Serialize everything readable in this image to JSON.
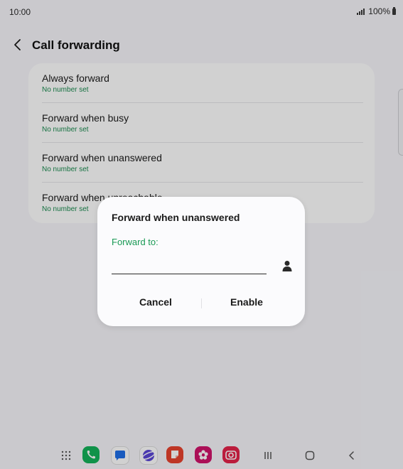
{
  "status_bar": {
    "time": "10:00",
    "battery": "100%"
  },
  "header": {
    "title": "Call forwarding"
  },
  "options": [
    {
      "title": "Always forward",
      "subtitle": "No number set"
    },
    {
      "title": "Forward when busy",
      "subtitle": "No number set"
    },
    {
      "title": "Forward when unanswered",
      "subtitle": "No number set"
    },
    {
      "title": "Forward when unreachable",
      "subtitle": "No number set"
    }
  ],
  "dialog": {
    "title": "Forward when unanswered",
    "field_label": "Forward to:",
    "field_value": "",
    "cancel_label": "Cancel",
    "enable_label": "Enable"
  },
  "nav": {
    "apps": [
      "apps-grid-icon",
      "phone-icon",
      "messages-icon",
      "internet-icon",
      "notes-icon",
      "flower-icon",
      "camera-icon"
    ],
    "system_buttons": [
      "recents-icon",
      "home-icon",
      "back-icon"
    ]
  },
  "colors": {
    "accent_green": "#1a9a55",
    "subtitle_green": "#1a8a4f",
    "background": "#f7f6fb",
    "dialog_bg": "#fbfbfd"
  }
}
